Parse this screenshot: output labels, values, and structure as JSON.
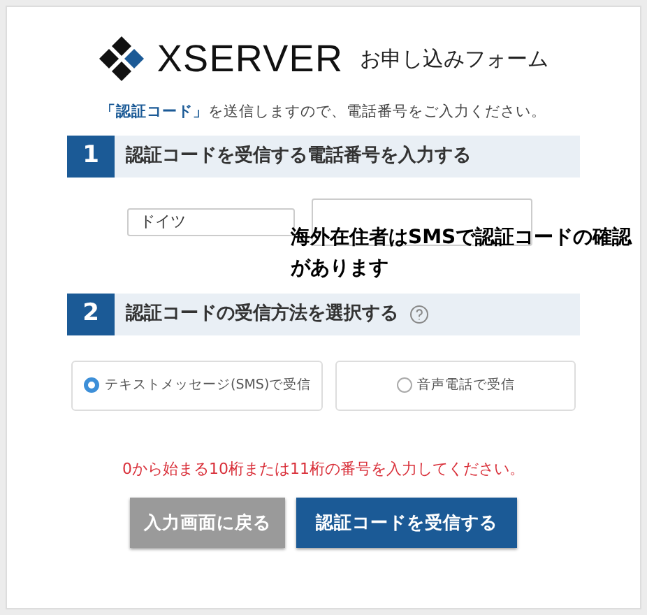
{
  "header": {
    "logo": "XSERVER",
    "subtitle": "お申し込みフォーム"
  },
  "lead": {
    "highlight": "「認証コード」",
    "rest": "を送信しますので、電話番号をご入力ください。"
  },
  "steps": [
    {
      "number": "1",
      "title": "認証コードを受信する電話番号を入力する",
      "help": false
    },
    {
      "number": "2",
      "title": "認証コードの受信方法を選択する",
      "help": true
    }
  ],
  "phone": {
    "country": "ドイツ"
  },
  "overlay_note": "海外在住者はSMSで認証コードの確認があります",
  "methods": [
    {
      "label": "テキストメッセージ(SMS)で受信",
      "selected": true
    },
    {
      "label": "音声電話で受信",
      "selected": false
    }
  ],
  "error": "0から始まる10桁または11桁の番号を入力してください。",
  "buttons": [
    {
      "label": "入力画面に戻る",
      "kind": "secondary"
    },
    {
      "label": "認証コードを受信する",
      "kind": "primary"
    }
  ]
}
